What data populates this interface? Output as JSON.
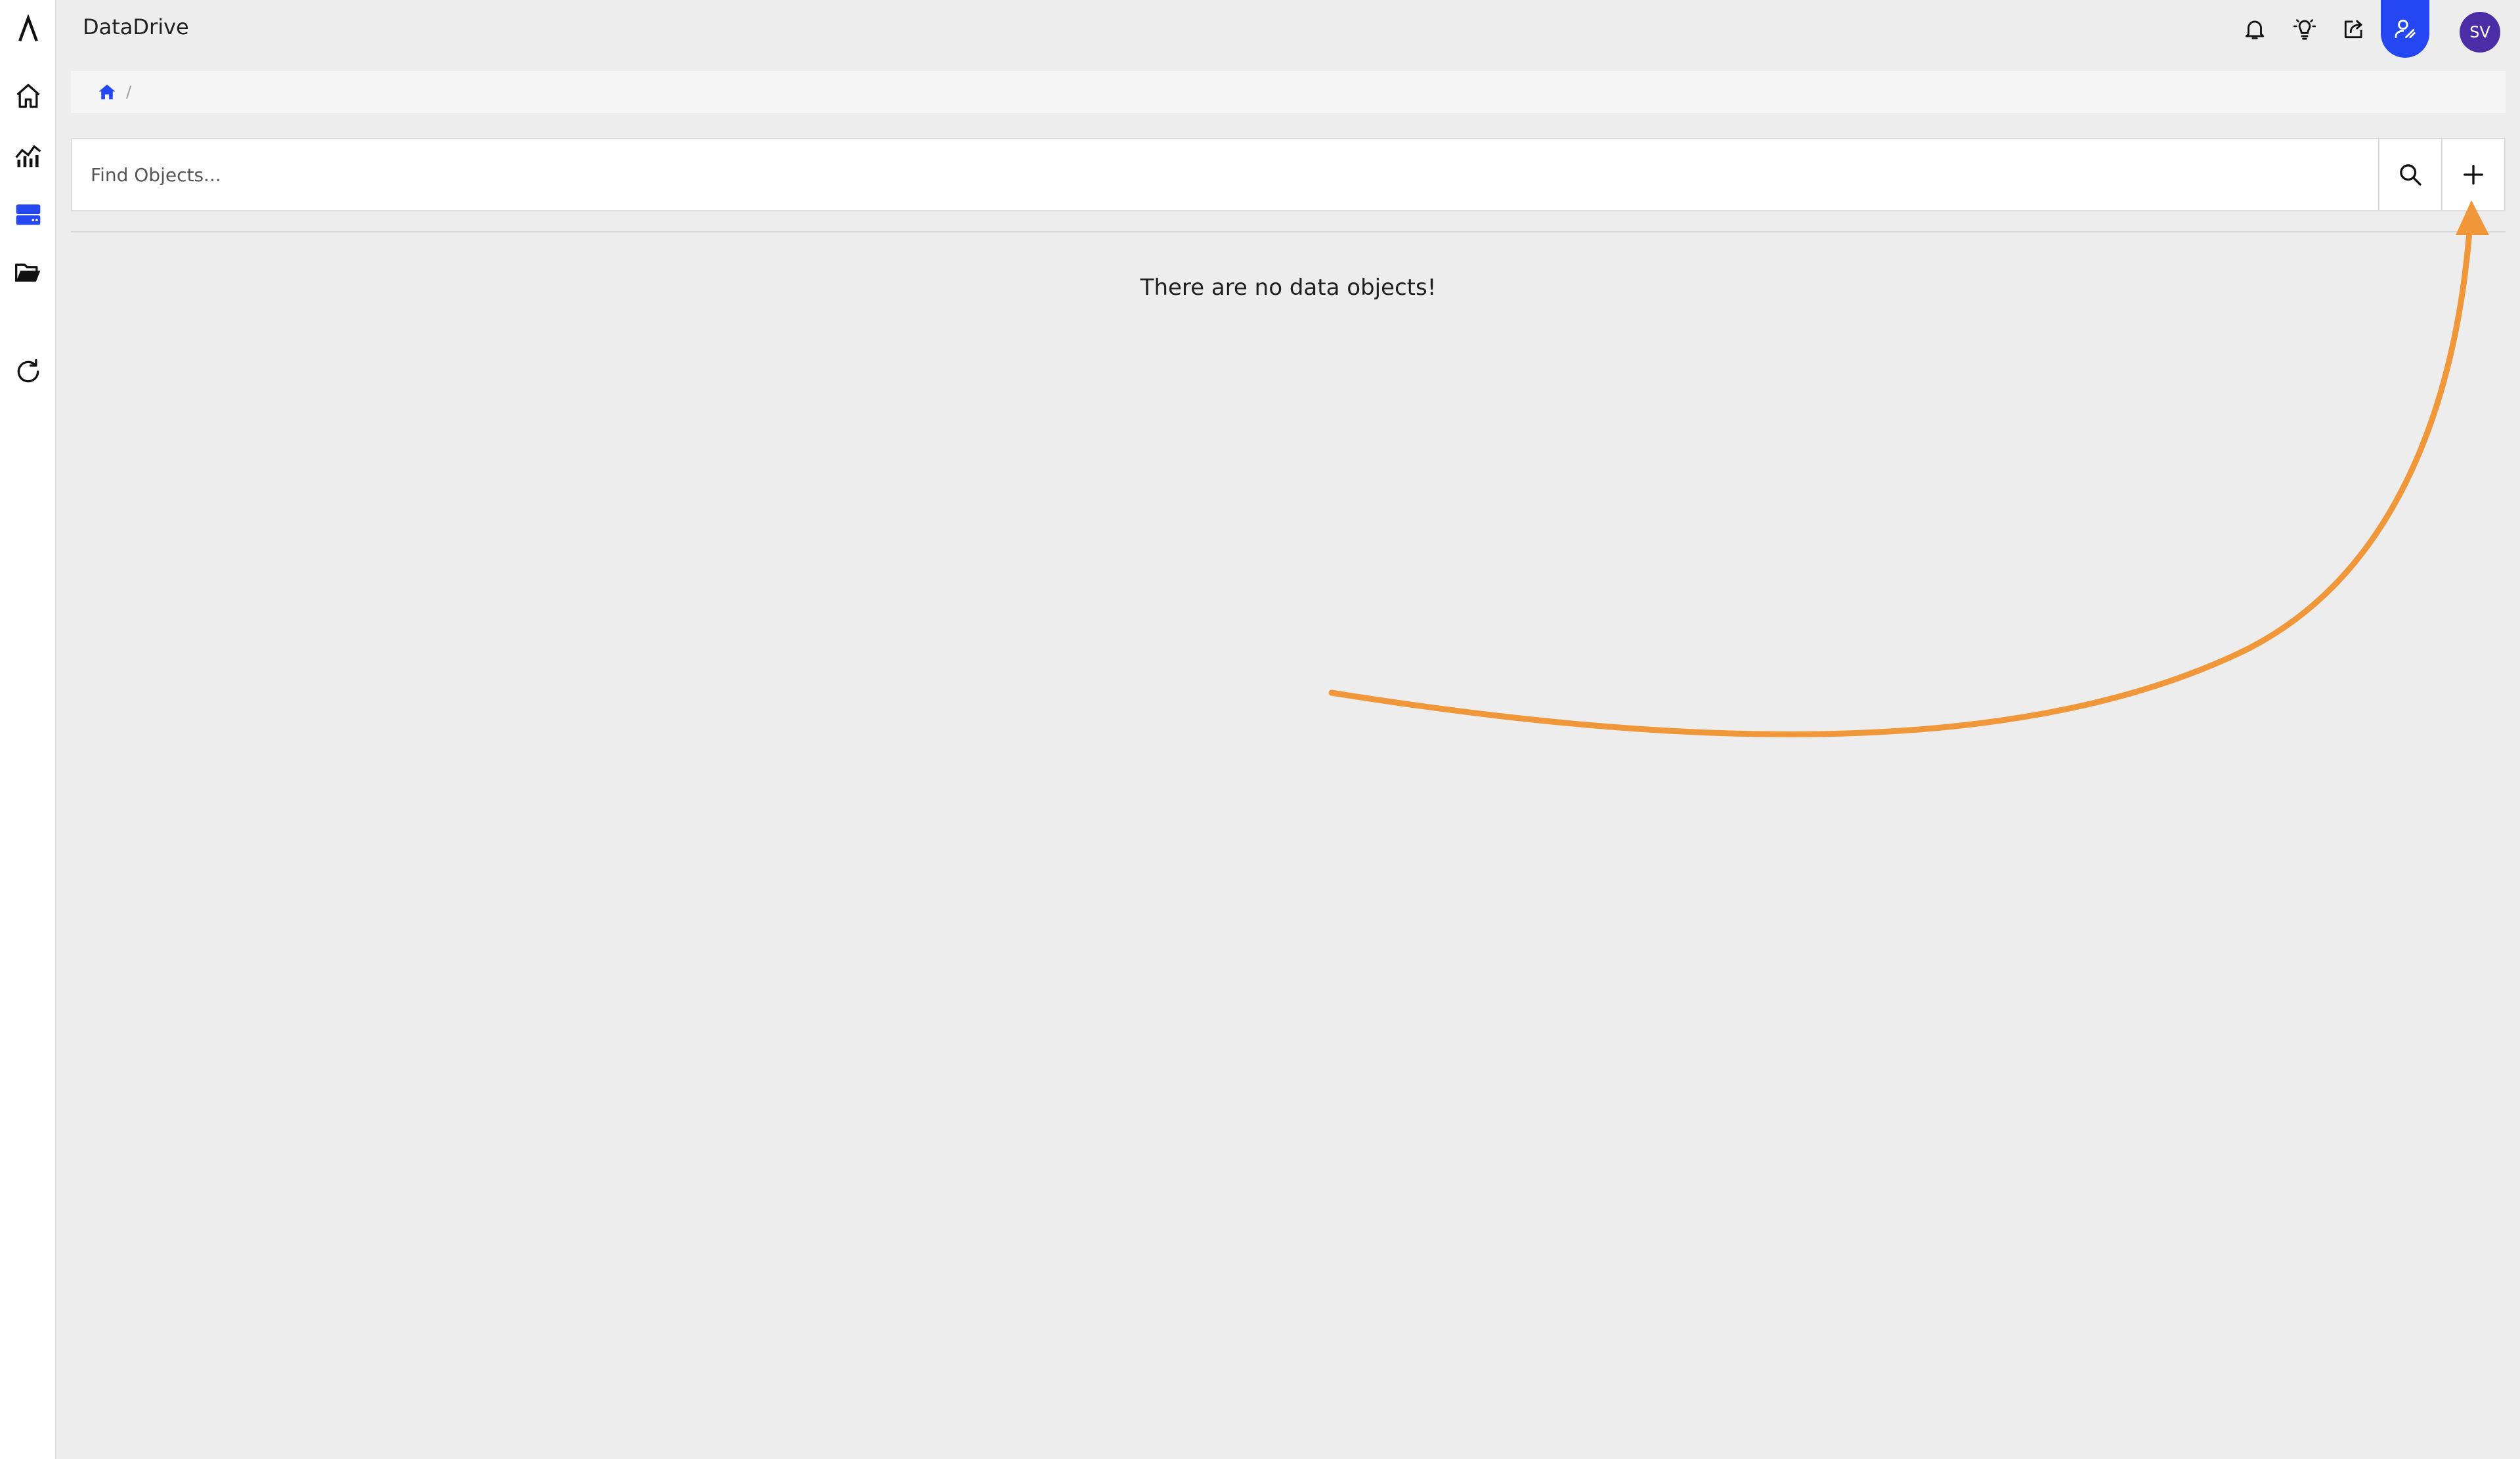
{
  "app": {
    "title": "DataDrive"
  },
  "sidebar": {
    "items": [
      {
        "icon": "logo-lambda-icon",
        "active": false
      },
      {
        "icon": "home-icon",
        "active": false
      },
      {
        "icon": "analytics-chart-icon",
        "active": false
      },
      {
        "icon": "data-drive-icon",
        "active": true
      },
      {
        "icon": "folder-open-icon",
        "active": false
      },
      {
        "icon": "refresh-icon",
        "active": false
      }
    ]
  },
  "topbar": {
    "icons": [
      "bell-icon",
      "lightbulb-icon",
      "share-icon",
      "user-admin-icon"
    ],
    "active_icon": "user-admin-icon",
    "avatar_initials": "SV"
  },
  "breadcrumb": {
    "home_icon": "home-icon",
    "separator": "/"
  },
  "search": {
    "placeholder": "Find Objects...",
    "value": ""
  },
  "content": {
    "empty_message": "There are no data objects!"
  },
  "colors": {
    "accent": "#2447f2",
    "avatar": "#4b2ea6",
    "annotation_arrow": "#f0973a",
    "background": "#ededed"
  }
}
